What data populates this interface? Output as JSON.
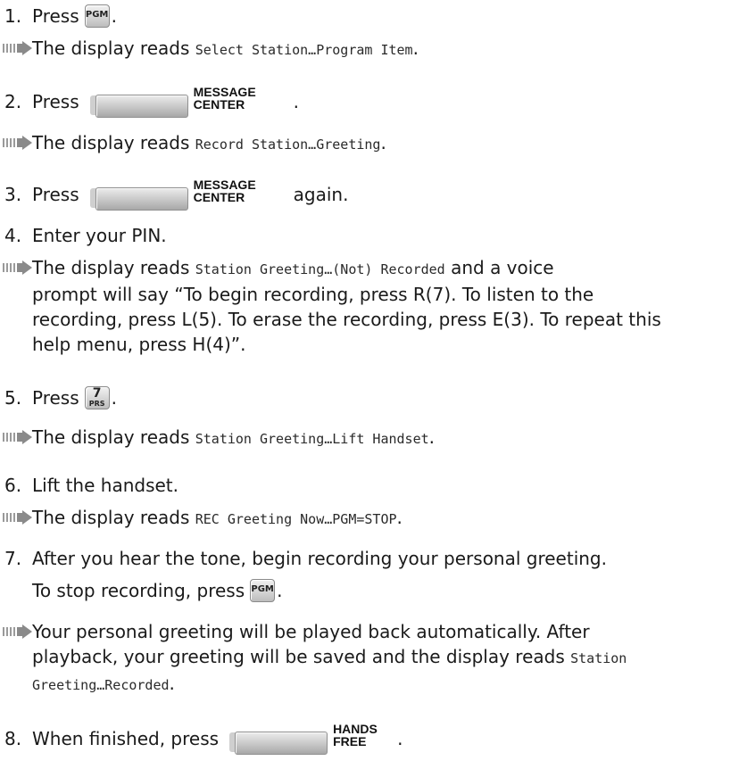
{
  "steps": [
    {
      "number": "1.",
      "text_before": "Press",
      "key": "PGM",
      "text_after": "."
    },
    {
      "result_text": "The display reads",
      "display": "Select Station…Program Item",
      "after": "."
    },
    {
      "number": "2.",
      "text_before": "Press",
      "key_line1": "MESSAGE",
      "key_line2": "CENTER",
      "text_after": "."
    },
    {
      "result_text": "The display reads",
      "display": "Record Station…Greeting",
      "after": "."
    },
    {
      "number": "3.",
      "text_before": "Press",
      "key_line1": "MESSAGE",
      "key_line2": "CENTER",
      "text_after": "again."
    },
    {
      "number": "4.",
      "text": "Enter your PIN."
    },
    {
      "result_line1_text": "The display reads",
      "result_line1_display": "Station Greeting…(Not) Recorded",
      "result_line1_after": "and a voice",
      "result_line2": "prompt will say “To begin recording, press R(7). To listen to the",
      "result_line3": "recording, press L(5). To erase the recording, press E(3). To repeat this",
      "result_line4": "help menu, press H(4)”."
    },
    {
      "number": "5.",
      "text_before": "Press",
      "key_top": "7",
      "key_bottom": "PRS",
      "text_after": "."
    },
    {
      "result_text": "The display reads",
      "display": "Station Greeting…Lift Handset",
      "after": "."
    },
    {
      "number": "6.",
      "text": "Lift the handset."
    },
    {
      "result_text": "The display reads",
      "display": "REC Greeting Now…PGM=STOP",
      "after": "."
    },
    {
      "number": "7.",
      "text_line1": "After you hear the tone, begin recording your personal greeting.",
      "text_line2": "To stop recording, press",
      "key": "PGM",
      "text_after": "."
    },
    {
      "result_line1": "Your personal greeting will be played back automatically. After",
      "result_line2_text": "playback, your greeting will be saved and the display reads",
      "result_line2_display": "Station",
      "result_line3_display": "Greeting…Recorded",
      "result_line3_after": "."
    },
    {
      "number": "8.",
      "text_before": "When finished, press",
      "key_line1": "HANDS",
      "key_line2": "FREE",
      "text_after": "."
    }
  ],
  "colors": {
    "text": "#1a1a1a",
    "arrow": "#8a8a8a",
    "key_face": "#d4d4d4"
  }
}
